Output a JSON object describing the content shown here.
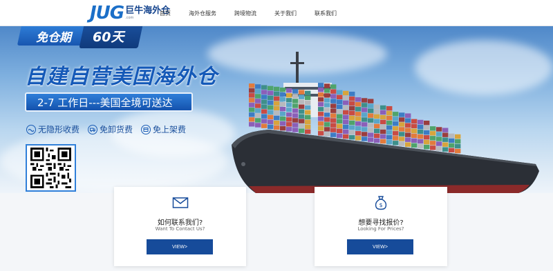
{
  "header": {
    "logo_mark": "JUG",
    "logo_cn": "巨牛海外仓",
    "logo_sub": ".com",
    "nav": [
      {
        "label": "首页"
      },
      {
        "label": "海外仓服务"
      },
      {
        "label": "跨境物流"
      },
      {
        "label": "关于我们"
      },
      {
        "label": "联系我们"
      }
    ]
  },
  "banner": {
    "badge_left": "免仓期",
    "badge_right": "60天",
    "headline": "自建自营美国海外仓",
    "pill": "2-7 工作日---美国全境可送达",
    "features": [
      {
        "label": "无隐形收费",
        "icon": "wave-icon"
      },
      {
        "label": "免卸货费",
        "icon": "truck-icon"
      },
      {
        "label": "免上架费",
        "icon": "box-icon"
      }
    ]
  },
  "cards": [
    {
      "title": "如何联系我们?",
      "subtitle": "Want To Contact Us?",
      "button": "VIEW>",
      "icon": "envelope-icon"
    },
    {
      "title": "想要寻找报价?",
      "subtitle": "Looking For Prices?",
      "button": "VIEW>",
      "icon": "money-bag-icon"
    }
  ],
  "colors": {
    "brand_blue": "#1459b8",
    "button_blue": "#164b9a",
    "nav_text": "#333333"
  }
}
